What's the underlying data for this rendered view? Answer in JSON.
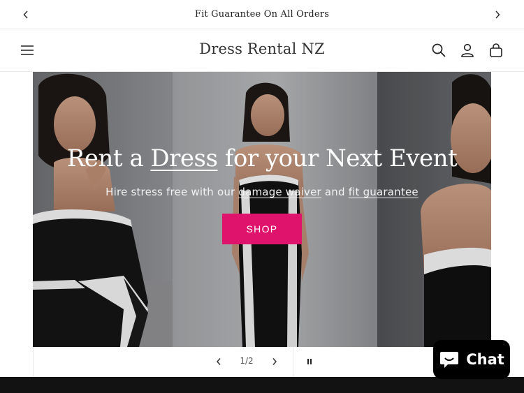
{
  "announcement": {
    "text": "Fit Guarantee On All Orders",
    "prev_icon": "chevron-left-icon",
    "next_icon": "chevron-right-icon"
  },
  "header": {
    "brand": "Dress Rental NZ",
    "icons": [
      "menu-icon",
      "search-icon",
      "account-icon",
      "cart-icon"
    ]
  },
  "hero": {
    "title_before": "Rent a ",
    "title_link": "Dress",
    "title_after": " for your Next Event",
    "subtitle_before": "Hire stress free with our ",
    "subtitle_link1": "damage waiver",
    "subtitle_middle": " and ",
    "subtitle_link2": "fit guarantee",
    "cta": "SHOP",
    "cta_color": "#e0136c"
  },
  "slider": {
    "counter": "1/2",
    "prev_icon": "chevron-left-icon",
    "next_icon": "chevron-right-icon",
    "pause_icon": "pause-icon"
  },
  "chat": {
    "label": "Chat",
    "icon": "chat-bubble-icon"
  }
}
